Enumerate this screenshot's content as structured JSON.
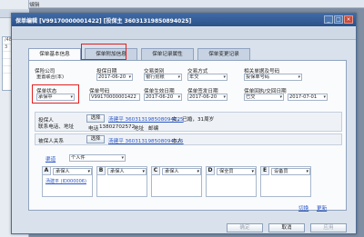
{
  "background": {
    "menu": [
      "文件",
      "查询/编辑"
    ],
    "side_lines": [
      "/487",
      "3",
      "",
      "",
      "",
      ""
    ]
  },
  "dialog": {
    "title": "保单编辑 [V99170000001422] [投保主 36031319850894025]",
    "controls": {
      "minimize": "_",
      "maximize": "□",
      "close": "×"
    }
  },
  "tabs": [
    {
      "label": "保单基本信息",
      "active": true
    },
    {
      "label": "保单附加信息",
      "active": false
    },
    {
      "label": "保单记录属性",
      "active": false
    },
    {
      "label": "保单变更记录",
      "active": false
    }
  ],
  "row1": {
    "insurer_label": "保险公司",
    "insurer_value": "重置联合(本)",
    "date_label": "投保日期",
    "date_value": "2017-06-20",
    "trade_type_label": "交易类别",
    "trade_type_value": "银行划账",
    "trade_mode_label": "交易方式",
    "trade_mode_value": "年交",
    "related_label": "相关单据及号码",
    "related_value": "投保单号码"
  },
  "row2": {
    "status_label": "保单状态",
    "status_value": "承保中",
    "policy_no_label": "保单号码",
    "policy_no_value": "V99170000001422",
    "effective_label": "保单生效日期",
    "effective_value": "2017-06-20",
    "issued_label": "保单签发日期",
    "issued_value": "2017-06-20",
    "recv_label": "保单回执/交回日期",
    "recv_status": "已交",
    "recv_date": "2017-07-01"
  },
  "applicant": {
    "title_line1": "投保人",
    "title_line2": "联系电话、地址",
    "select_label": "选择",
    "holder_link": "汤建平 360313198508094025",
    "holder_info": "女，已婚，31周岁",
    "phone_label": "电话",
    "phone_value": "13802702572",
    "addr_label": "地址",
    "addr_value": "邮编"
  },
  "insured": {
    "title": "被保人关系",
    "select_label": "选择",
    "person_link": "汤建平 360313198508094025",
    "relation_label": "本人"
  },
  "beneficiary": {
    "section_label": "渠道",
    "type_value": "个人件",
    "cards": [
      {
        "letter": "A",
        "field": "承保人",
        "value": "汤建平 (ID000006)"
      },
      {
        "letter": "B",
        "field": "承保人",
        "value": ""
      },
      {
        "letter": "C",
        "field": "承保人",
        "value": ""
      },
      {
        "letter": "D",
        "field": "保全员",
        "value": ""
      },
      {
        "letter": "E",
        "field": "设备员",
        "value": ""
      }
    ],
    "links": [
      "切换",
      "更新"
    ]
  },
  "footer": {
    "buttons": [
      {
        "label": "确定",
        "disabled": true
      },
      {
        "label": "取消",
        "disabled": false
      },
      {
        "label": "应用",
        "disabled": true
      }
    ]
  }
}
